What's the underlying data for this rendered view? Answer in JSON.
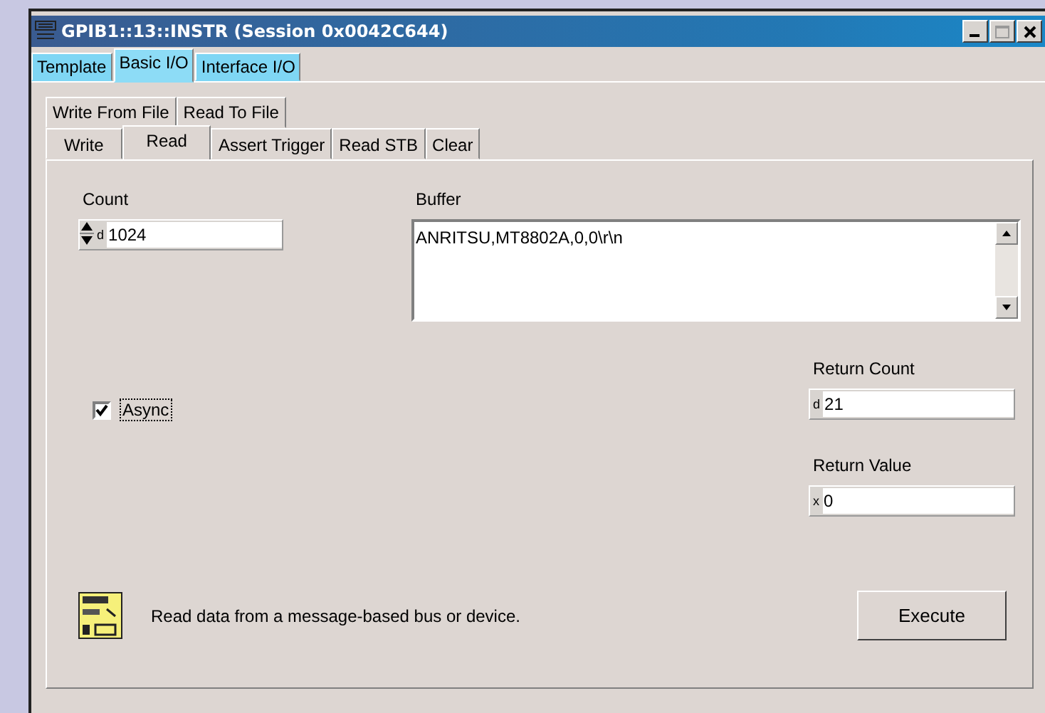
{
  "window": {
    "title": "GPIB1::13::INSTR (Session 0x0042C644)"
  },
  "tabs": [
    {
      "label": "Template",
      "selected": false
    },
    {
      "label": "Basic I/O",
      "selected": true
    },
    {
      "label": "Interface I/O",
      "selected": false
    }
  ],
  "subtabs_row1": [
    {
      "label": "Write From File",
      "selected": false
    },
    {
      "label": "Read To File",
      "selected": false
    }
  ],
  "subtabs_row2": [
    {
      "label": "Write",
      "selected": false
    },
    {
      "label": "Read",
      "selected": true
    },
    {
      "label": "Assert Trigger",
      "selected": false
    },
    {
      "label": "Read STB",
      "selected": false
    },
    {
      "label": "Clear",
      "selected": false
    }
  ],
  "count": {
    "label": "Count",
    "prefix": "d",
    "value": "1024"
  },
  "buffer": {
    "label": "Buffer",
    "value": "ANRITSU,MT8802A,0,0\\r\\n"
  },
  "async": {
    "label": "Async",
    "checked": true
  },
  "return_count": {
    "label": "Return Count",
    "prefix": "d",
    "value": "21"
  },
  "return_value": {
    "label": "Return Value",
    "prefix": "x",
    "value": "0"
  },
  "description": "Read data from a message-based bus or device.",
  "execute_button": "Execute"
}
